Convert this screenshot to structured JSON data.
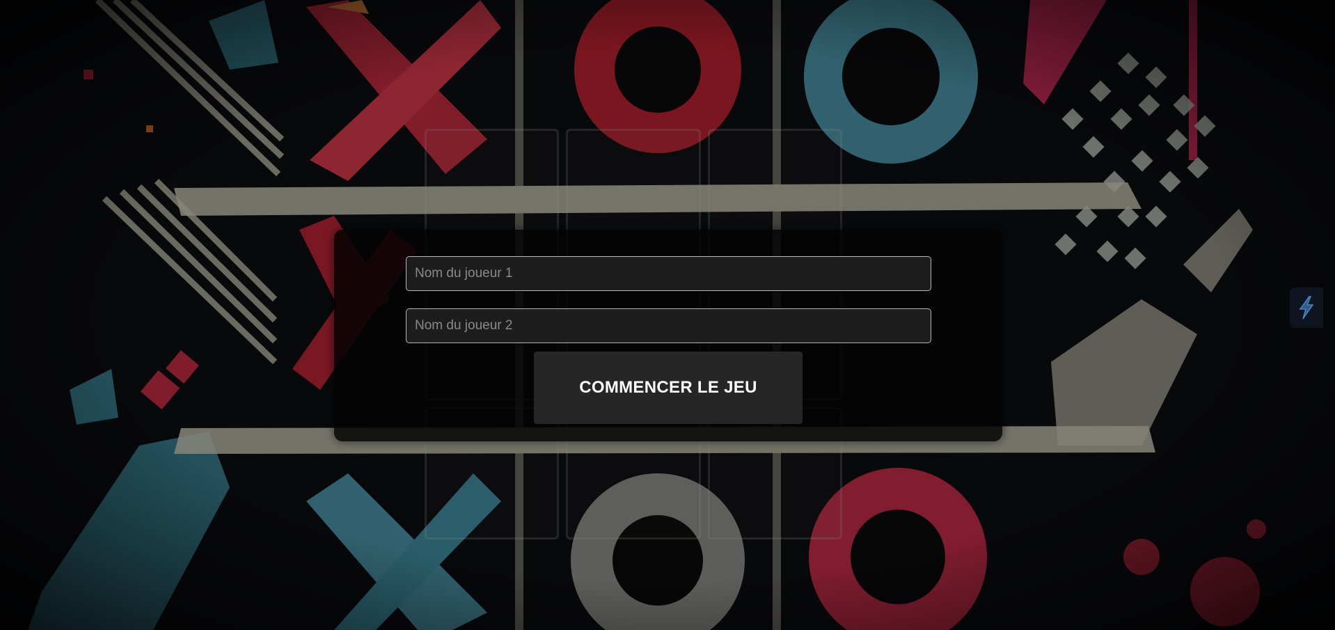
{
  "form": {
    "player1_placeholder": "Nom du joueur 1",
    "player1_value": "",
    "player2_placeholder": "Nom du joueur 2",
    "player2_value": "",
    "start_label": "COMMENCER LE JEU"
  },
  "side_widget": {
    "icon": "lightning-bolt-icon"
  },
  "background": {
    "theme": "tic-tac-toe graffiti artwork",
    "accent_red": "#c8283f",
    "accent_teal": "#4a9aae",
    "accent_cream": "#d8d6c4"
  }
}
